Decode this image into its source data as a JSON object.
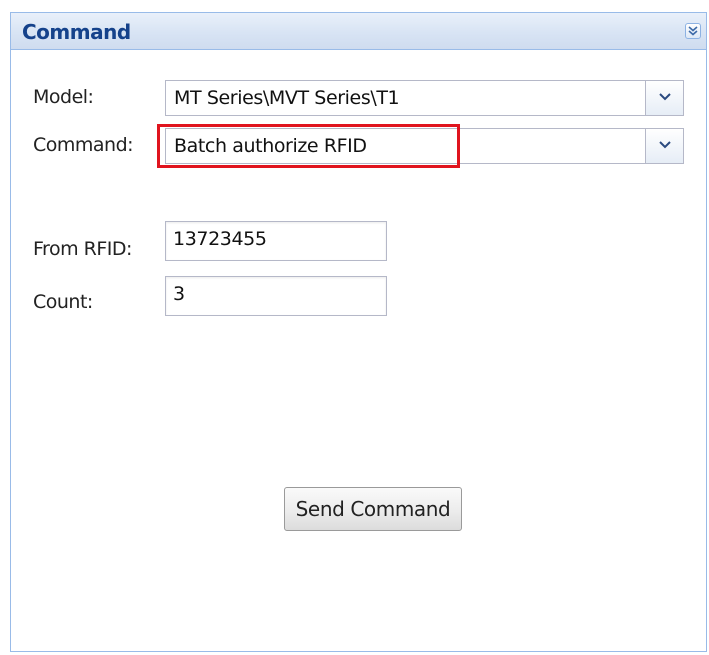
{
  "panel": {
    "title": "Command",
    "collapse_icon": "double-chevron-down-icon"
  },
  "form": {
    "model_label": "Model:",
    "model_value": "MT Series\\MVT Series\\T1",
    "command_label": "Command:",
    "command_value": "Batch authorize RFID",
    "from_rfid_label": "From RFID:",
    "from_rfid_value": "13723455",
    "count_label": "Count:",
    "count_value": "3"
  },
  "actions": {
    "send_label": "Send Command"
  },
  "colors": {
    "header_text": "#15428b",
    "panel_border": "#99bbe8",
    "highlight": "#e0141e"
  }
}
